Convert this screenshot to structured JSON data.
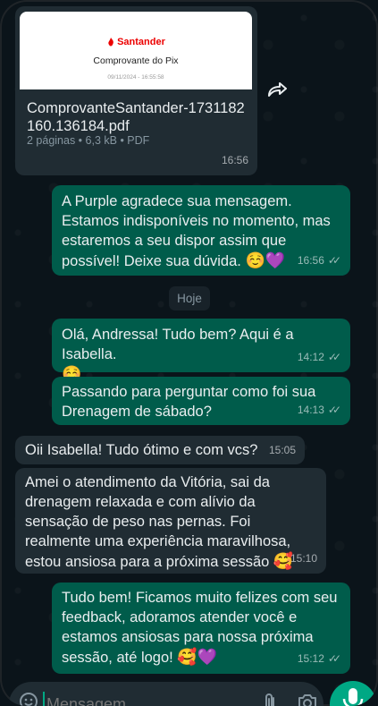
{
  "document_message": {
    "bank_name": "Santander",
    "card_title": "Comprovante do Pix",
    "card_date": "09/11/2024 - 16:55:58",
    "file_name": "ComprovanteSantander-1731182160.136184.pdf",
    "file_name_line1": "ComprovanteSantander-1731182",
    "file_name_line2": "160.136184.pdf",
    "meta": "2 páginas • 6,3 kB • PDF",
    "time": "16:56"
  },
  "messages": [
    {
      "direction": "out",
      "text": "A Purple agradece sua mensagem. Estamos indisponíveis no momento, mas estaremos a seu dispor assim que possível! Deixe sua dúvida.",
      "emoji": "☺️💜",
      "time": "16:56",
      "status": "read"
    },
    {
      "direction": "out",
      "text": "Olá, Andressa! Tudo bem? Aqui é a Isabella.",
      "emoji": "☺️",
      "time": "14:12",
      "status": "read"
    },
    {
      "direction": "out",
      "text": "Passando para perguntar como foi sua Drenagem de sábado?",
      "time": "14:13",
      "status": "read"
    },
    {
      "direction": "in",
      "text": "Oii Isabella! Tudo ótimo e com vcs?",
      "time": "15:05"
    },
    {
      "direction": "in",
      "text": "Amei o atendimento da Vitória, sai da drenagem relaxada e com alívio da sensação de peso nas pernas. Foi realmente uma experiência maravilhosa, estou ansiosa para a próxima sessão",
      "emoji": "🥰",
      "time": "15:10"
    },
    {
      "direction": "out",
      "text": "Tudo bem! Ficamos muito felizes com seu feedback, adoramos atender você e estamos ansiosas para nossa próxima sessão, até logo!",
      "emoji": "🥰💜",
      "time": "15:12",
      "status": "read"
    }
  ],
  "day_separator": "Hoje",
  "composer": {
    "placeholder": "Mensagem"
  },
  "icons": {
    "forward": "forward-icon",
    "emoji": "emoji-icon",
    "attach": "paperclip-icon",
    "camera": "camera-icon",
    "mic": "mic-icon",
    "read_status": "double-check-icon"
  },
  "colors": {
    "background": "#0b141a",
    "incoming_bubble": "#202c33",
    "outgoing_bubble": "#005c4b",
    "accent": "#00a884"
  }
}
